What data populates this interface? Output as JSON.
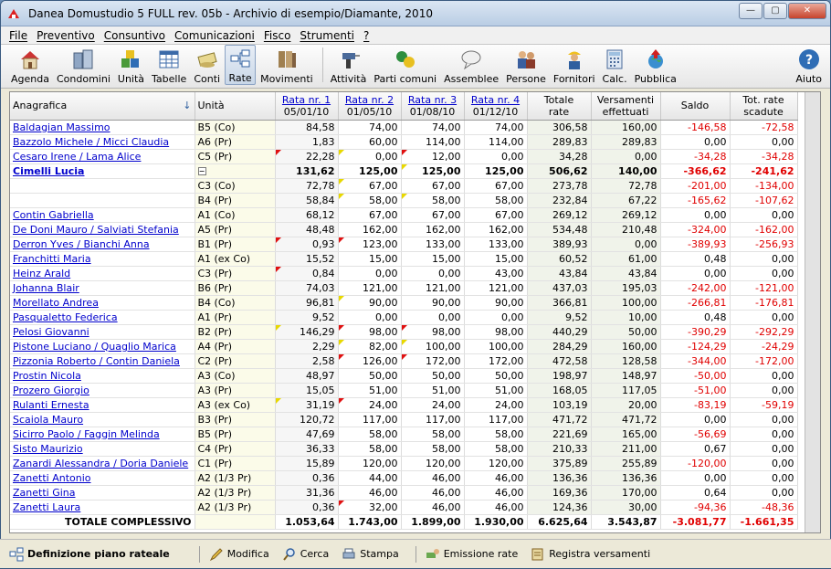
{
  "window": {
    "title": "Danea Domustudio 5 FULL rev. 05b - Archivio di esempio/Diamante, 2010"
  },
  "menu": [
    "File",
    "Preventivo",
    "Consuntivo",
    "Comunicazioni",
    "Fisco",
    "Strumenti",
    "?"
  ],
  "toolbar": [
    "Agenda",
    "Condomini",
    "Unità",
    "Tabelle",
    "Conti",
    "Rate",
    "Movimenti",
    "Attività",
    "Parti comuni",
    "Assemblee",
    "Persone",
    "Fornitori",
    "Calc.",
    "Pubblica",
    "Aiuto"
  ],
  "table": {
    "headers": {
      "anagrafica": "Anagrafica",
      "unita": "Unità",
      "r1a": "Rata nr. 1",
      "r1b": "05/01/10",
      "r2a": "Rata nr. 2",
      "r2b": "01/05/10",
      "r3a": "Rata nr. 3",
      "r3b": "01/08/10",
      "r4a": "Rata nr. 4",
      "r4b": "01/12/10",
      "tota": "Totale",
      "totb": "rate",
      "vera": "Versamenti",
      "verb": "effettuati",
      "saldo": "Saldo",
      "scada": "Tot. rate",
      "scadb": "scadute"
    },
    "rows": [
      [
        "Baldagian Massimo",
        "B5 (Co)",
        "84,58",
        "74,00",
        "74,00",
        "74,00",
        "306,58",
        "160,00",
        "-146,58",
        "-72,58"
      ],
      [
        "Bazzolo Michele / Micci Claudia",
        "A6 (Pr)",
        "1,83",
        "60,00",
        "114,00",
        "114,00",
        "289,83",
        "289,83",
        "0,00",
        "0,00"
      ],
      [
        "Cesaro Irene / Lama Alice",
        "C5 (Pr)",
        "22,28",
        "0,00",
        "12,00",
        "0,00",
        "34,28",
        "0,00",
        "-34,28",
        "-34,28"
      ],
      [
        "Cimelli Lucia",
        "",
        "131,62",
        "125,00",
        "125,00",
        "125,00",
        "506,62",
        "140,00",
        "-366,62",
        "-241,62"
      ],
      [
        "",
        "C3 (Co)",
        "72,78",
        "67,00",
        "67,00",
        "67,00",
        "273,78",
        "72,78",
        "-201,00",
        "-134,00"
      ],
      [
        "",
        "B4 (Pr)",
        "58,84",
        "58,00",
        "58,00",
        "58,00",
        "232,84",
        "67,22",
        "-165,62",
        "-107,62"
      ],
      [
        "Contin Gabriella",
        "A1 (Co)",
        "68,12",
        "67,00",
        "67,00",
        "67,00",
        "269,12",
        "269,12",
        "0,00",
        "0,00"
      ],
      [
        "De Doni Mauro / Salviati Stefania",
        "A5 (Pr)",
        "48,48",
        "162,00",
        "162,00",
        "162,00",
        "534,48",
        "210,48",
        "-324,00",
        "-162,00"
      ],
      [
        "Derron Yves / Bianchi Anna",
        "B1 (Pr)",
        "0,93",
        "123,00",
        "133,00",
        "133,00",
        "389,93",
        "0,00",
        "-389,93",
        "-256,93"
      ],
      [
        "Franchitti Maria",
        "A1 (ex Co)",
        "15,52",
        "15,00",
        "15,00",
        "15,00",
        "60,52",
        "61,00",
        "0,48",
        "0,00"
      ],
      [
        "Heinz Arald",
        "C3 (Pr)",
        "0,84",
        "0,00",
        "0,00",
        "43,00",
        "43,84",
        "43,84",
        "0,00",
        "0,00"
      ],
      [
        "Johanna Blair",
        "B6 (Pr)",
        "74,03",
        "121,00",
        "121,00",
        "121,00",
        "437,03",
        "195,03",
        "-242,00",
        "-121,00"
      ],
      [
        "Morellato Andrea",
        "B4 (Co)",
        "96,81",
        "90,00",
        "90,00",
        "90,00",
        "366,81",
        "100,00",
        "-266,81",
        "-176,81"
      ],
      [
        "Pasqualetto Federica",
        "A1 (Pr)",
        "9,52",
        "0,00",
        "0,00",
        "0,00",
        "9,52",
        "10,00",
        "0,48",
        "0,00"
      ],
      [
        "Pelosi Giovanni",
        "B2 (Pr)",
        "146,29",
        "98,00",
        "98,00",
        "98,00",
        "440,29",
        "50,00",
        "-390,29",
        "-292,29"
      ],
      [
        "Pistone Luciano / Quaglio Marica",
        "A4 (Pr)",
        "2,29",
        "82,00",
        "100,00",
        "100,00",
        "284,29",
        "160,00",
        "-124,29",
        "-24,29"
      ],
      [
        "Pizzonia Roberto / Contin Daniela",
        "C2 (Pr)",
        "2,58",
        "126,00",
        "172,00",
        "172,00",
        "472,58",
        "128,58",
        "-344,00",
        "-172,00"
      ],
      [
        "Prostin Nicola",
        "A3 (Co)",
        "48,97",
        "50,00",
        "50,00",
        "50,00",
        "198,97",
        "148,97",
        "-50,00",
        "0,00"
      ],
      [
        "Prozero Giorgio",
        "A3 (Pr)",
        "15,05",
        "51,00",
        "51,00",
        "51,00",
        "168,05",
        "117,05",
        "-51,00",
        "0,00"
      ],
      [
        "Rulanti Ernesta",
        "A3 (ex Co)",
        "31,19",
        "24,00",
        "24,00",
        "24,00",
        "103,19",
        "20,00",
        "-83,19",
        "-59,19"
      ],
      [
        "Scaiola Mauro",
        "B3 (Pr)",
        "120,72",
        "117,00",
        "117,00",
        "117,00",
        "471,72",
        "471,72",
        "0,00",
        "0,00"
      ],
      [
        "Sicirro Paolo / Faggin Melinda",
        "B5 (Pr)",
        "47,69",
        "58,00",
        "58,00",
        "58,00",
        "221,69",
        "165,00",
        "-56,69",
        "0,00"
      ],
      [
        "Sisto Maurizio",
        "C4 (Pr)",
        "36,33",
        "58,00",
        "58,00",
        "58,00",
        "210,33",
        "211,00",
        "0,67",
        "0,00"
      ],
      [
        "Zanardi Alessandra / Doria Daniele",
        "C1 (Pr)",
        "15,89",
        "120,00",
        "120,00",
        "120,00",
        "375,89",
        "255,89",
        "-120,00",
        "0,00"
      ],
      [
        "Zanetti Antonio",
        "A2 (1/3 Pr)",
        "0,36",
        "44,00",
        "46,00",
        "46,00",
        "136,36",
        "136,36",
        "0,00",
        "0,00"
      ],
      [
        "Zanetti Gina",
        "A2 (1/3 Pr)",
        "31,36",
        "46,00",
        "46,00",
        "46,00",
        "169,36",
        "170,00",
        "0,64",
        "0,00"
      ],
      [
        "Zanetti Laura",
        "A2 (1/3 Pr)",
        "0,36",
        "32,00",
        "46,00",
        "46,00",
        "124,36",
        "30,00",
        "-94,36",
        "-48,36"
      ]
    ],
    "flags": {
      "2-2": "r",
      "2-3": "y",
      "2-4": "r",
      "3-4": "y",
      "4-3": "y",
      "5-3": "y",
      "5-4": "y",
      "8-2": "r",
      "8-3": "r",
      "10-2": "r",
      "12-3": "y",
      "14-2": "y",
      "14-3": "r",
      "14-4": "r",
      "15-3": "y",
      "15-4": "y",
      "16-3": "r",
      "16-4": "r",
      "19-2": "y",
      "19-3": "r",
      "26-3": "r"
    },
    "total": [
      "TOTALE COMPLESSIVO",
      "",
      "1.053,64",
      "1.743,00",
      "1.899,00",
      "1.930,00",
      "6.625,64",
      "3.543,87",
      "-3.081,77",
      "-1.661,35"
    ]
  },
  "statusbar": {
    "title": "Definizione piano rateale",
    "modifica": "Modifica",
    "cerca": "Cerca",
    "stampa": "Stampa",
    "emissione": "Emissione rate",
    "registra": "Registra versamenti"
  }
}
